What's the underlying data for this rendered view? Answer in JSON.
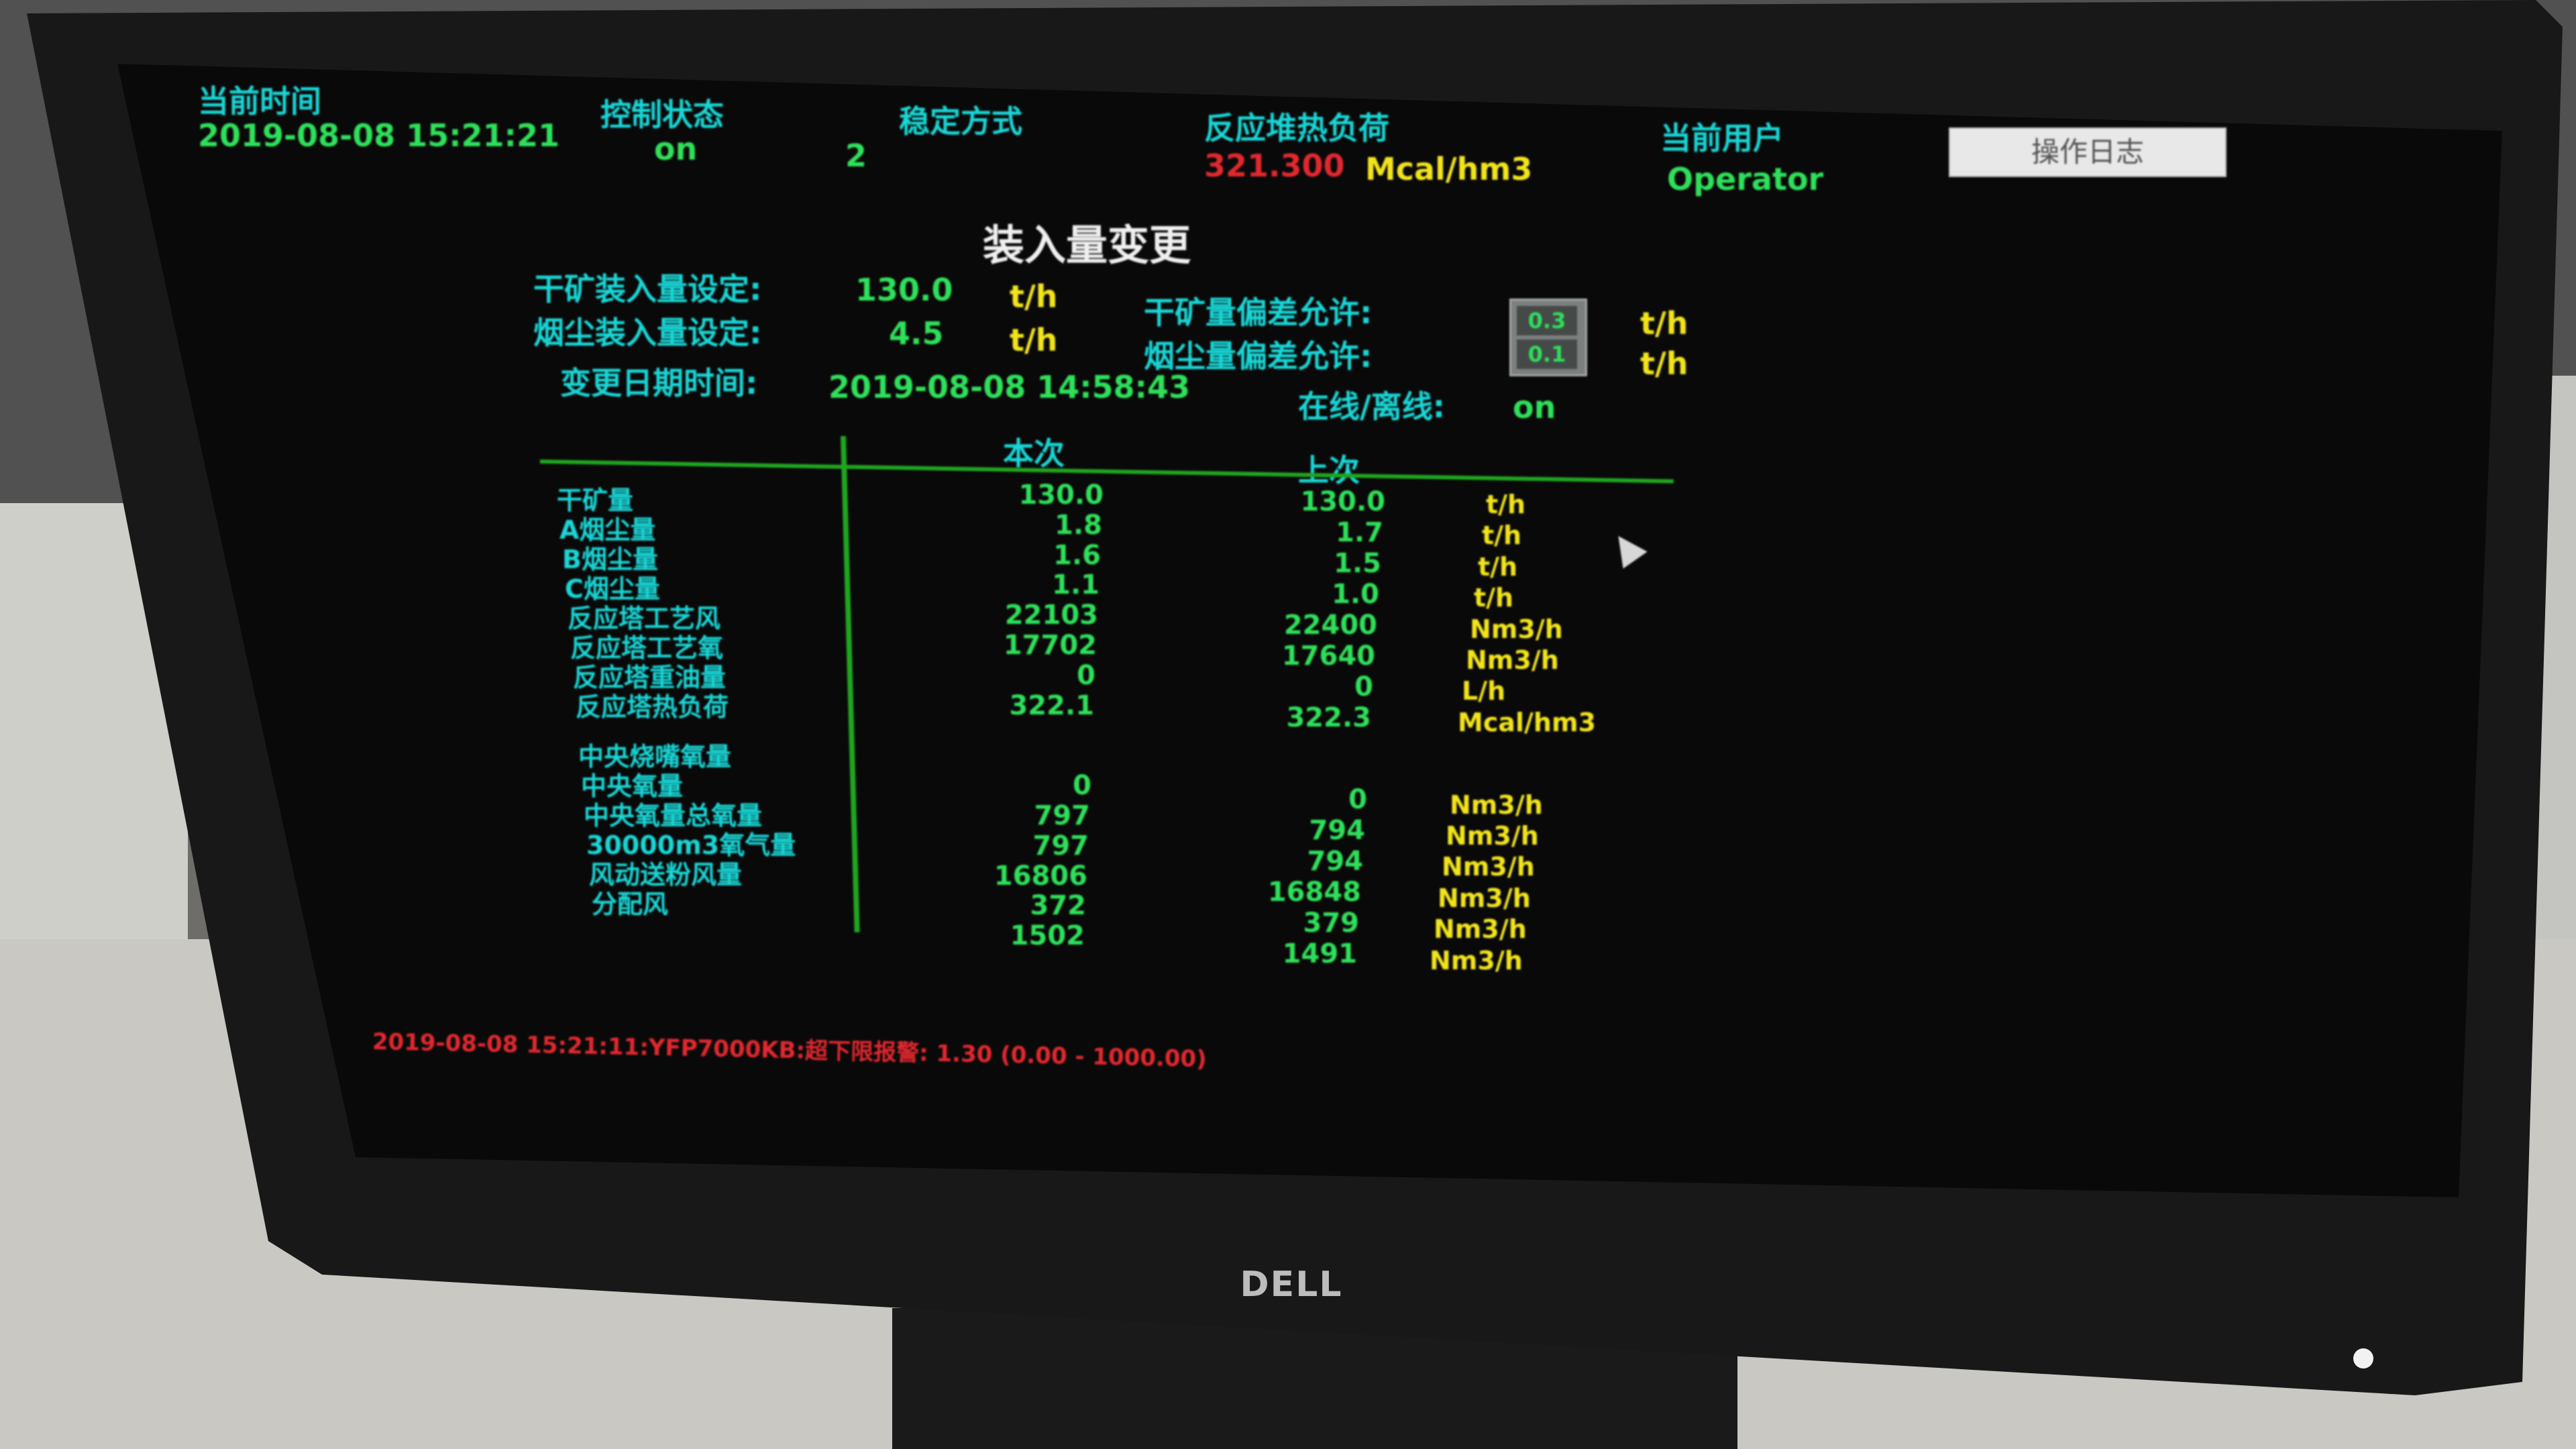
{
  "header": {
    "time_label": "当前时间",
    "time_value": "2019-08-08 15:21:21",
    "control_state_label": "控制状态",
    "control_state_value": "on",
    "mode_label": "稳定方式",
    "mode_value": "2",
    "heat_load_label": "反应堆热负荷",
    "heat_load_value": "321.300",
    "heat_load_unit": "Mcal/hm3",
    "user_label": "当前用户",
    "user_value": "Operator",
    "log_button": "操作日志"
  },
  "title": "装入量变更",
  "settings": {
    "dry_ore_label": "干矿装入量设定:",
    "dry_ore_value": "130.0",
    "dry_ore_unit": "t/h",
    "dust_label": "烟尘装入量设定:",
    "dust_value": "4.5",
    "dust_unit": "t/h",
    "dry_ore_tol_label": "干矿量偏差允许:",
    "dust_tol_label": "烟尘量偏差允许:",
    "dry_ore_tol_value": "0.3",
    "dust_tol_value": "0.1",
    "tol_unit_1": "t/h",
    "tol_unit_2": "t/h",
    "change_time_label": "变更日期时间:",
    "change_time_value": "2019-08-08 14:58:43",
    "online_label": "在线/离线:",
    "online_value": "on"
  },
  "table": {
    "col_current": "本次",
    "col_previous": "上次",
    "rows": [
      {
        "label": "干矿量",
        "current": "130.0",
        "previous": "130.0",
        "unit": "t/h"
      },
      {
        "label": "A烟尘量",
        "current": "1.8",
        "previous": "1.7",
        "unit": "t/h"
      },
      {
        "label": "B烟尘量",
        "current": "1.6",
        "previous": "1.5",
        "unit": "t/h"
      },
      {
        "label": "C烟尘量",
        "current": "1.1",
        "previous": "1.0",
        "unit": "t/h"
      },
      {
        "label": "反应塔工艺风",
        "current": "22103",
        "previous": "22400",
        "unit": "Nm3/h"
      },
      {
        "label": "反应塔工艺氧",
        "current": "17702",
        "previous": "17640",
        "unit": "Nm3/h"
      },
      {
        "label": "反应塔重油量",
        "current": "0",
        "previous": "0",
        "unit": "L/h"
      },
      {
        "label": "反应塔热负荷",
        "current": "322.1",
        "previous": "322.3",
        "unit": "Mcal/hm3"
      },
      {
        "label": "中央烧嘴氧量",
        "current": "",
        "previous": "",
        "unit": ""
      },
      {
        "label": "中央氧量",
        "current": "0",
        "previous": "0",
        "unit": "Nm3/h"
      },
      {
        "label": "中央氧量总氧量",
        "current": "797",
        "previous": "794",
        "unit": "Nm3/h"
      },
      {
        "label": "30000m3氧气量",
        "current": "797",
        "previous": "794",
        "unit": "Nm3/h"
      },
      {
        "label": "风动送粉风量",
        "current": "16806",
        "previous": "16848",
        "unit": "Nm3/h"
      },
      {
        "label": "分配风",
        "current": "372",
        "previous": "379",
        "unit": "Nm3/h"
      },
      {
        "label": "",
        "current": "1502",
        "previous": "1491",
        "unit": "Nm3/h"
      }
    ]
  },
  "alarm_line": "2019-08-08 15:21:11:YFP7000KB:超下限报警: 1.30 (0.00 - 1000.00)",
  "brand": "DELL"
}
